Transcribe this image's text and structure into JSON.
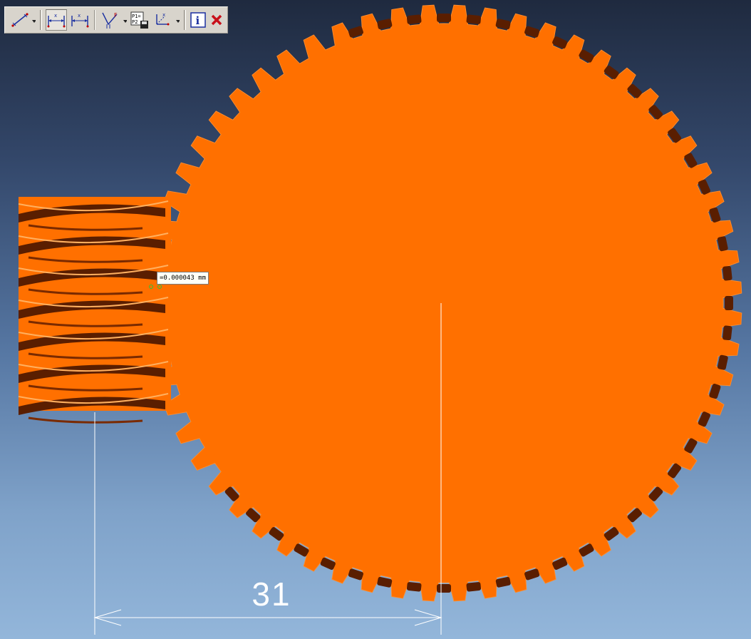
{
  "toolbar": {
    "buttons": [
      {
        "name": "measure-distance",
        "icon": "measure-distance-icon",
        "has_dropdown": true,
        "pressed": false
      },
      {
        "name": "measure-horizontal",
        "icon": "horizontal-dimension-icon",
        "has_dropdown": false,
        "pressed": true
      },
      {
        "name": "measure-horizontal-alt",
        "icon": "horizontal-dimension-alt-icon",
        "has_dropdown": false,
        "pressed": false
      },
      {
        "name": "measure-angle",
        "icon": "angle-measure-icon",
        "has_dropdown": true,
        "pressed": false
      },
      {
        "name": "save-points",
        "icon": "p1-p2-save-icon",
        "label": "P1=P2",
        "has_dropdown": false,
        "pressed": false
      },
      {
        "name": "coordinate-system",
        "icon": "coordinate-axes-icon",
        "has_dropdown": true,
        "pressed": false
      },
      {
        "name": "info",
        "icon": "info-icon",
        "has_dropdown": false,
        "pressed": false
      },
      {
        "name": "close",
        "icon": "close-icon",
        "has_dropdown": false,
        "pressed": false
      }
    ]
  },
  "measurement": {
    "readout": "=0.000043 mm",
    "dimension_value": "31"
  },
  "scene": {
    "objects": [
      "worm-gear",
      "spur-gear"
    ],
    "gear_color": "#ff7000",
    "gear_dark": "#5a1e00",
    "background_top": "#1f2a3f",
    "background_bottom": "#93b6da"
  }
}
